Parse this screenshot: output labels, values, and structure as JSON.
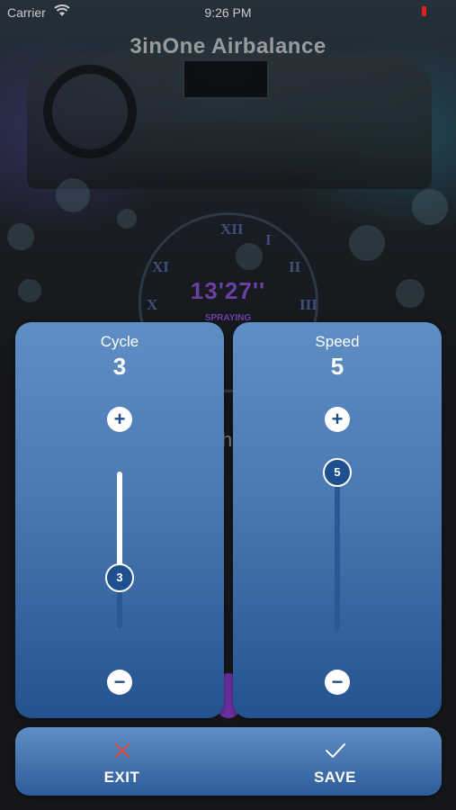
{
  "status_bar": {
    "carrier": "Carrier",
    "time": "9:26 PM",
    "wifi_icon": "wifi-icon",
    "battery_icon": "battery-low-icon",
    "battery_color": "#e0201a"
  },
  "app": {
    "title": "3inOne Airbalance"
  },
  "background": {
    "timer": "13'27''",
    "timer_status": "SPRAYING",
    "timer_color": "#6b3fa3",
    "clock_numerals": [
      "XII",
      "I",
      "II",
      "III",
      "X",
      "XI"
    ],
    "partial_text": "h"
  },
  "cycle": {
    "label": "Cycle",
    "value": "3",
    "knob_value": "3",
    "level": 3,
    "min": 1,
    "max": 5,
    "increase_icon": "plus-icon",
    "decrease_icon": "minus-icon"
  },
  "speed": {
    "label": "Speed",
    "value": "5",
    "knob_value": "5",
    "level": 5,
    "min": 1,
    "max": 5,
    "increase_icon": "plus-icon",
    "decrease_icon": "minus-icon"
  },
  "actions": {
    "exit_label": "EXIT",
    "exit_icon": "close-x-icon",
    "exit_icon_color": "#e0453a",
    "save_label": "SAVE",
    "save_icon": "checkmark-icon"
  },
  "colors": {
    "card_top": "#5f8ec5",
    "card_bottom": "#23528f",
    "knob": "#1e4f8f"
  }
}
